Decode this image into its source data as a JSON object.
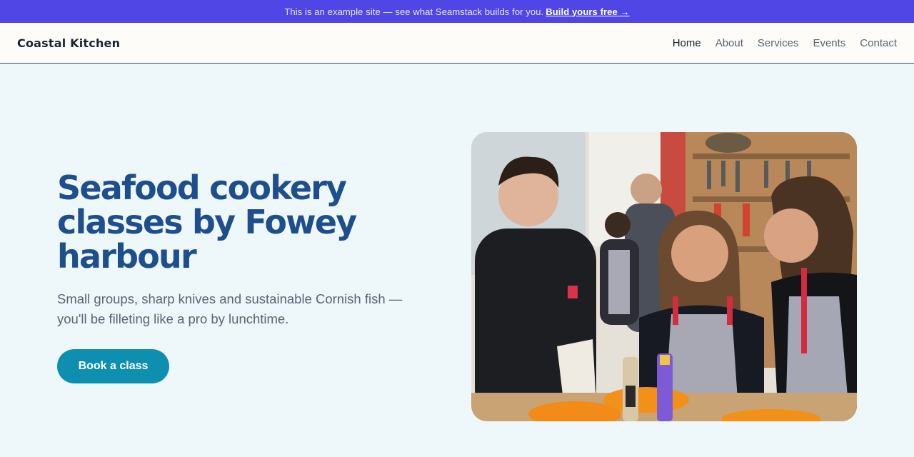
{
  "banner": {
    "text": "This is an example site — see what Seamstack builds for you.",
    "link_label": "Build yours free →"
  },
  "site": {
    "brand": "Coastal Kitchen"
  },
  "nav": {
    "items": [
      {
        "label": "Home"
      },
      {
        "label": "About"
      },
      {
        "label": "Services"
      },
      {
        "label": "Events"
      },
      {
        "label": "Contact"
      }
    ],
    "active": "Home"
  },
  "hero": {
    "title_lines": [
      "Seafood cookery",
      "classes by Fowey",
      "harbour"
    ],
    "subtitle_lines": [
      "Small groups, sharp knives and sustainable Cornish fish —",
      "you'll be filleting like a pro by lunchtime."
    ],
    "cta_label": "Book a class",
    "image_description": "photo-cookery-class"
  },
  "colors": {
    "banner_bg": "#4f46e5",
    "page_bg": "#eef7fa",
    "title": "#1e4f8c",
    "cta_bg": "#0e8fb0"
  }
}
